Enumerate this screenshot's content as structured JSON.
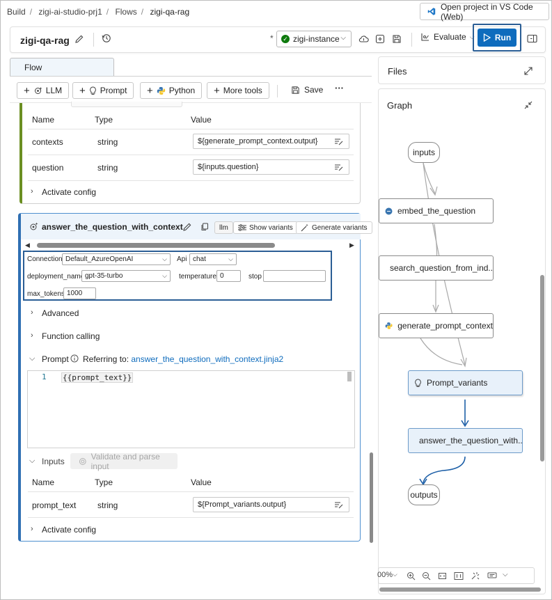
{
  "breadcrumb": {
    "items": [
      "Build",
      "zigi-ai-studio-prj1",
      "Flows",
      "zigi-qa-rag"
    ],
    "sep": "/"
  },
  "vscode_button": {
    "label": "Open project in VS Code (Web)"
  },
  "header": {
    "title": "zigi-qa-rag",
    "unsaved_marker": "*",
    "runtime": "zigi-instance",
    "evaluate_label": "Evaluate",
    "run_label": "Run"
  },
  "tabs": {
    "flow": "Flow"
  },
  "toolbar": {
    "llm": "LLM",
    "prompt": "Prompt",
    "python": "Python",
    "more_tools": "More tools",
    "save": "Save",
    "more": "···"
  },
  "node_prev": {
    "columns": [
      "Name",
      "Type",
      "Value"
    ],
    "rows": [
      {
        "name": "contexts",
        "type": "string",
        "value": "${generate_prompt_context.output}"
      },
      {
        "name": "question",
        "type": "string",
        "value": "${inputs.question}"
      }
    ],
    "activate_config": "Activate config"
  },
  "node_llm": {
    "title": "answer_the_question_with_context",
    "type_badge": "llm",
    "show_variants": "Show variants",
    "generate_variants": "Generate variants",
    "params": {
      "connection_label": "Connection",
      "connection_value": "Default_AzureOpenAI",
      "api_label": "Api",
      "api_value": "chat",
      "deployment_label": "deployment_name",
      "deployment_value": "gpt-35-turbo",
      "temperature_label": "temperature",
      "temperature_value": "0",
      "stop_label": "stop",
      "stop_value": "",
      "max_tokens_label": "max_tokens",
      "max_tokens_value": "1000"
    },
    "advanced": "Advanced",
    "function_calling": "Function calling",
    "prompt_label": "Prompt",
    "referring_to": "Referring to:",
    "prompt_file": "answer_the_question_with_context.jinja2",
    "editor": {
      "line_no": "1",
      "code": "{{prompt_text}}"
    },
    "inputs_label": "Inputs",
    "validate_label": "Validate and parse input",
    "columns": [
      "Name",
      "Type",
      "Value"
    ],
    "rows": [
      {
        "name": "prompt_text",
        "type": "string",
        "value": "${Prompt_variants.output}"
      }
    ],
    "activate_config": "Activate config"
  },
  "files_panel": {
    "label": "Files"
  },
  "graph_panel": {
    "label": "Graph",
    "nodes": {
      "inputs": "inputs",
      "embed": "embed_the_question",
      "search": "search_question_from_ind...",
      "generate": "generate_prompt_context",
      "prompt_variants": "Prompt_variants",
      "answer": "answer_the_question_with...",
      "outputs": "outputs"
    },
    "zoom": "00%"
  },
  "colors": {
    "accent": "#0f6cbd",
    "prev_node_bar": "#6b8f22",
    "llm_node_border": "#2f6fb3",
    "success": "#0e7a0d"
  }
}
